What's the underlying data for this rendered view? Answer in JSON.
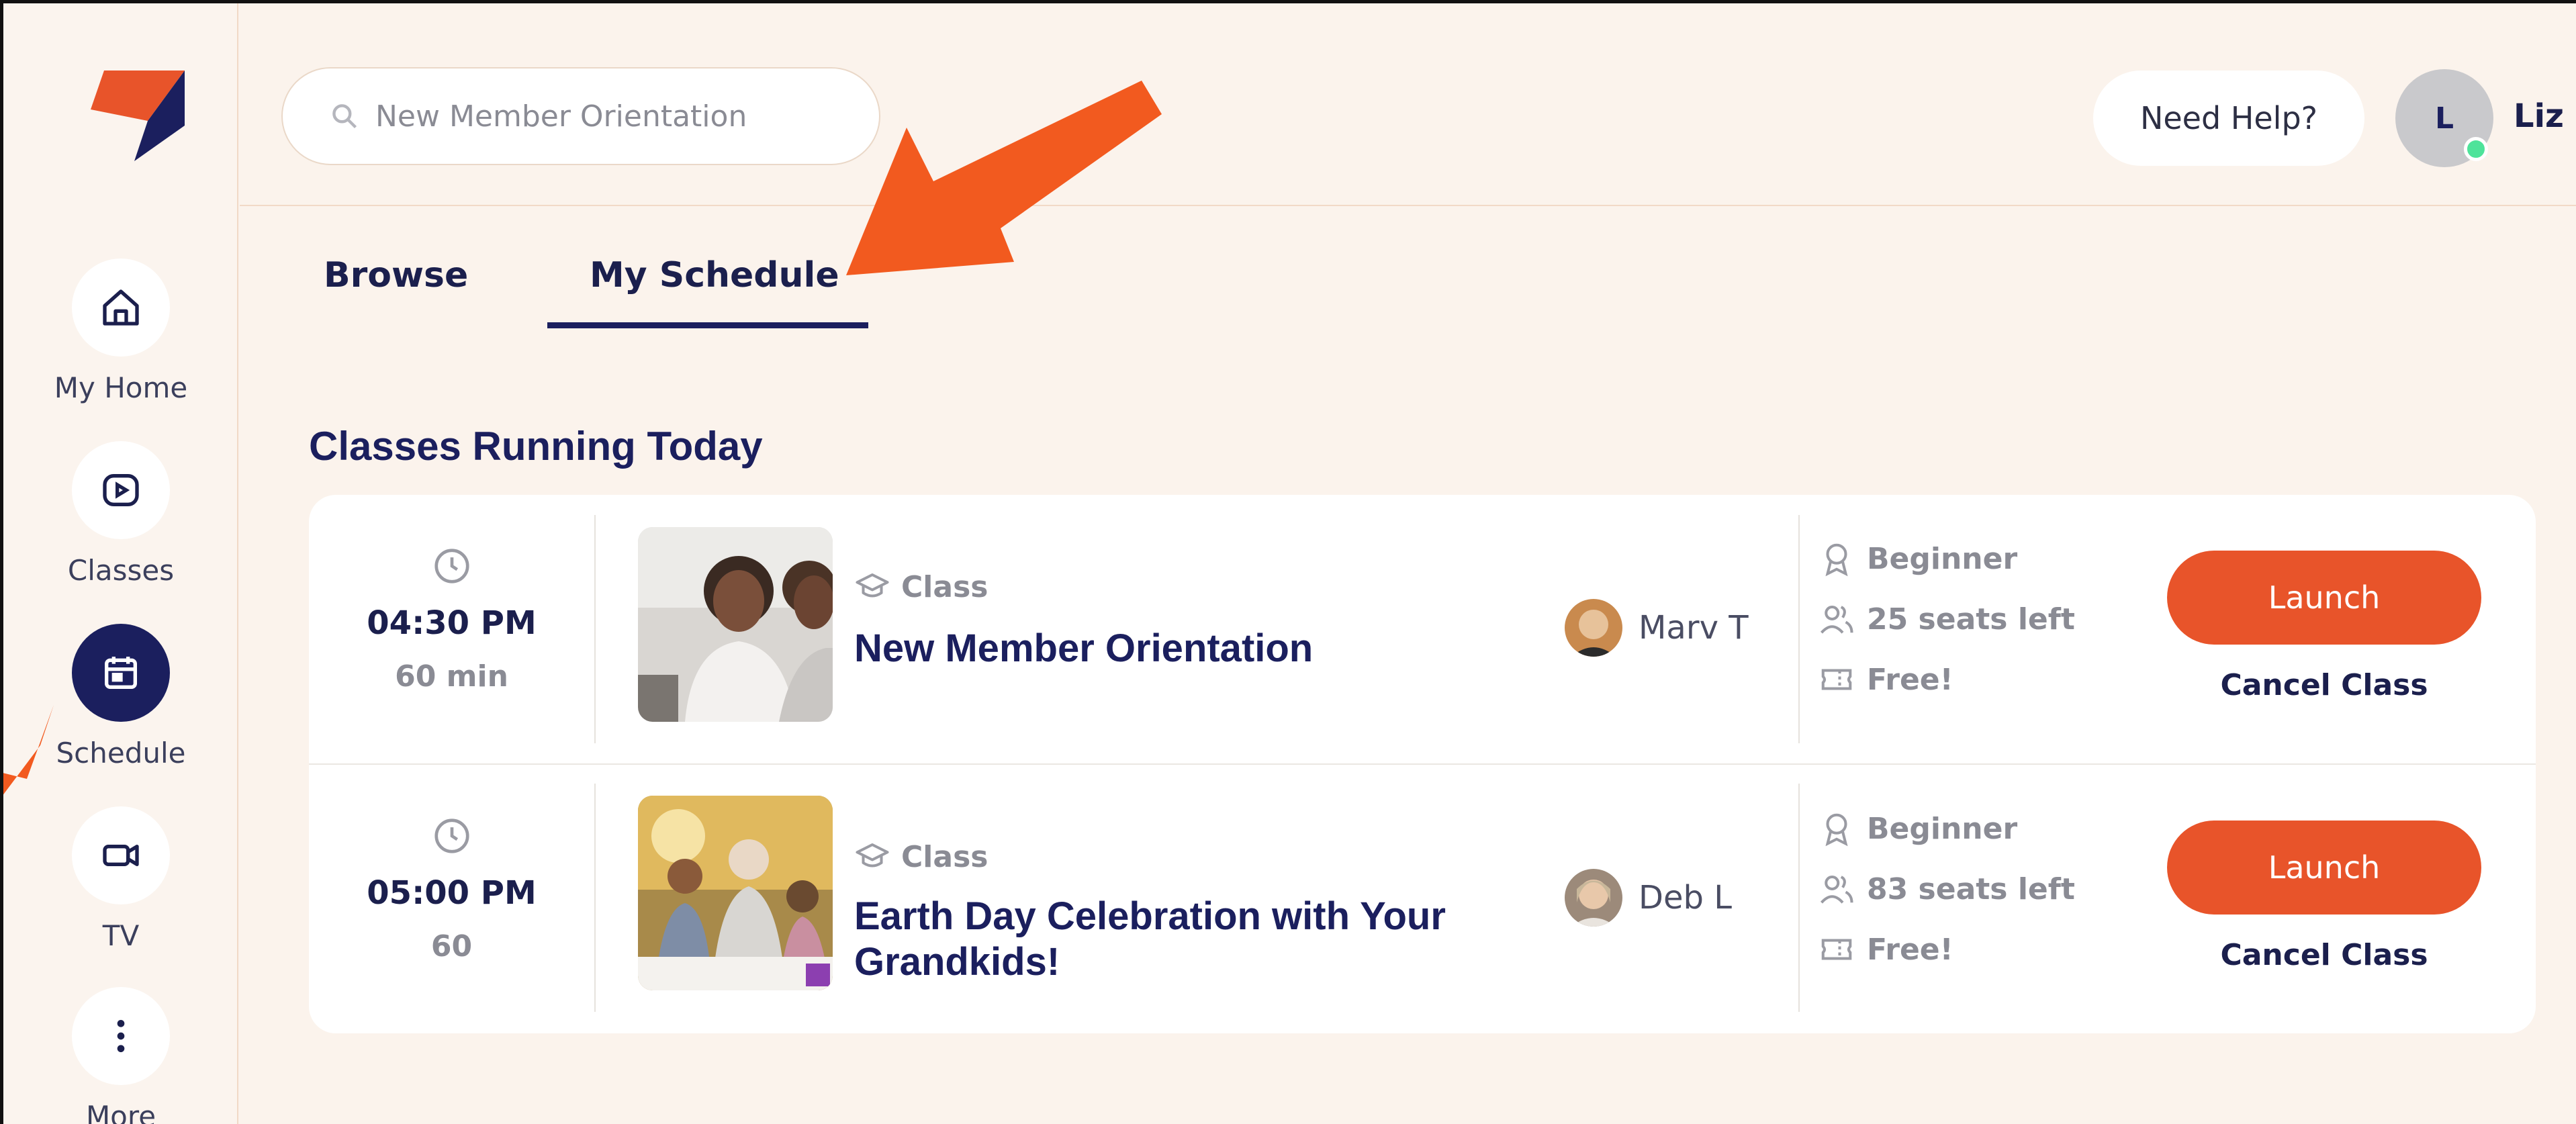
{
  "search": {
    "value": "New Member Orientation"
  },
  "header": {
    "help_label": "Need Help?",
    "avatar_initial": "L",
    "user_name": "Liz"
  },
  "sidebar": {
    "items": [
      {
        "label": "My Home",
        "icon": "home-icon"
      },
      {
        "label": "Classes",
        "icon": "play-icon"
      },
      {
        "label": "Schedule",
        "icon": "calendar-icon",
        "active": true
      },
      {
        "label": "TV",
        "icon": "video-icon"
      },
      {
        "label": "More",
        "icon": "more-vertical-icon"
      }
    ]
  },
  "tabs": [
    {
      "label": "Browse"
    },
    {
      "label": "My Schedule",
      "active": true
    }
  ],
  "section_title": "Classes Running Today",
  "classes": [
    {
      "time": "04:30 PM",
      "duration": "60 min",
      "kind": "Class",
      "title": "New Member Orientation",
      "instructor": "Marv T",
      "level": "Beginner",
      "seats": "25 seats left",
      "price": "Free!",
      "launch_label": "Launch",
      "cancel_label": "Cancel Class"
    },
    {
      "time": "05:00 PM",
      "duration": "60",
      "kind": "Class",
      "title": "Earth Day Celebration with Your Grandkids!",
      "instructor": "Deb L",
      "level": "Beginner",
      "seats": "83 seats left",
      "price": "Free!",
      "launch_label": "Launch",
      "cancel_label": "Cancel Class"
    }
  ],
  "colors": {
    "background": "#fbf3ec",
    "navy": "#1b1f5e",
    "accent": "#e8542a",
    "muted": "#8a8b94",
    "online": "#4ee39a"
  }
}
